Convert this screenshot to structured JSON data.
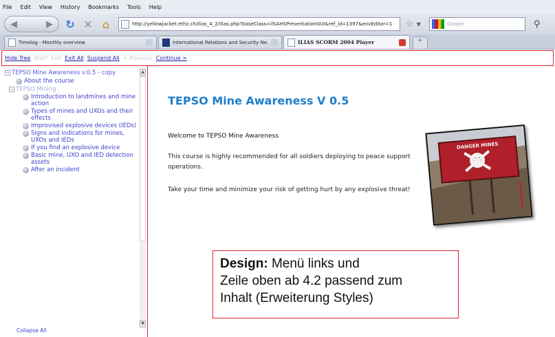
{
  "menubar": [
    "File",
    "Edit",
    "View",
    "History",
    "Bookmarks",
    "Tools",
    "Help"
  ],
  "browser": {
    "url": "http://yellowjacket.ethz.ch/ilias_4_2/ilias.php?baseClass=ilSAHSPresentationGUI&ref_id=1397&envEditor=1",
    "search_placeholder": "Google"
  },
  "tabs": [
    {
      "label": "Timelog - Monthly overview",
      "active": false
    },
    {
      "label": "International Relations and Security Ne...",
      "active": false
    },
    {
      "label": "ILIAS SCORM 2004 Player",
      "active": true
    }
  ],
  "controls": [
    {
      "label": "Hide Tree",
      "enabled": true
    },
    {
      "label": "Start",
      "enabled": false
    },
    {
      "label": "Exit",
      "enabled": false
    },
    {
      "label": "Exit All",
      "enabled": true
    },
    {
      "label": "Suspend All",
      "enabled": true
    },
    {
      "label": "< Previous",
      "enabled": false
    },
    {
      "label": "Continue >",
      "enabled": true
    }
  ],
  "tree": {
    "root": "TEPSO Mine Awareness v.0.5 - copy",
    "about": "About the course",
    "folder": "TEPSO Mining",
    "items": [
      "Introduction to landmines and mine action",
      "Types of mines and UXOs and their effects",
      "Improvised explosive devices (IEDs)",
      "Signs and indications for mines, UXOs and IEDs",
      "If you find an explosive device",
      "Basic mine, UXO and IED detection assets",
      "After an incident"
    ],
    "collapse": "Collapse All"
  },
  "content": {
    "title": "TEPSO Mine Awareness V 0.5",
    "welcome": "Welcome to TEPSO Mine Awareness",
    "para1": "This course is highly recommended for all soldiers deploying to peace support operations.",
    "para2": "Take your time and minimize your risk of getting hurt by any explosive threat!",
    "sign_text": "DANGER MINES"
  },
  "annotation": {
    "label": "Design:",
    "line1": " Menü links und",
    "line2": "Zeile oben ab 4.2 passend zum",
    "line3": "Inhalt (Erweiterung Styles)"
  },
  "colors": {
    "accent_red": "#d9262d",
    "link_blue": "#1a1aa8",
    "title_blue": "#1f7ec9"
  }
}
